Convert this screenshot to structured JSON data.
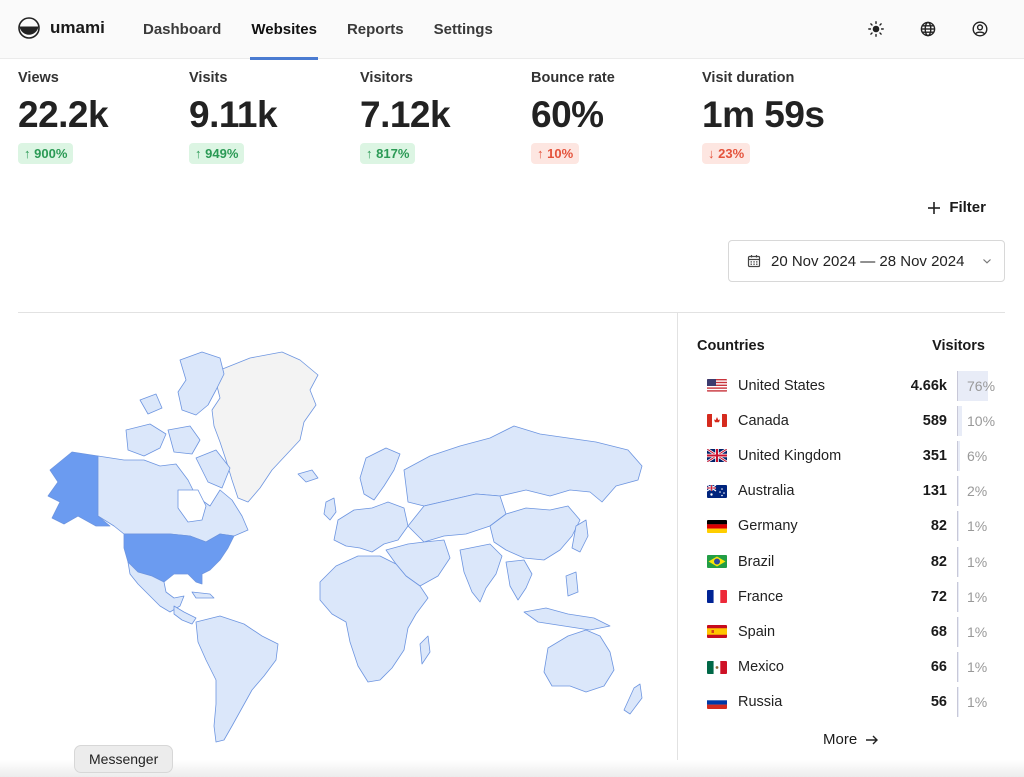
{
  "app": {
    "name": "umami"
  },
  "nav": {
    "items": [
      {
        "label": "Dashboard",
        "active": false
      },
      {
        "label": "Websites",
        "active": true
      },
      {
        "label": "Reports",
        "active": false
      },
      {
        "label": "Settings",
        "active": false
      }
    ]
  },
  "top_icons": [
    "sun-icon",
    "globe-icon",
    "user-icon"
  ],
  "metrics": [
    {
      "label": "Views",
      "value": "22.2k",
      "change": "900%",
      "direction": "up",
      "sentiment": "good"
    },
    {
      "label": "Visits",
      "value": "9.11k",
      "change": "949%",
      "direction": "up",
      "sentiment": "good"
    },
    {
      "label": "Visitors",
      "value": "7.12k",
      "change": "817%",
      "direction": "up",
      "sentiment": "good"
    },
    {
      "label": "Bounce rate",
      "value": "60%",
      "change": "10%",
      "direction": "up",
      "sentiment": "bad"
    },
    {
      "label": "Visit duration",
      "value": "1m 59s",
      "change": "23%",
      "direction": "down",
      "sentiment": "bad"
    }
  ],
  "filter": {
    "label": "Filter"
  },
  "date_range": {
    "label": "20 Nov 2024 — 28 Nov 2024"
  },
  "countries": {
    "header_left": "Countries",
    "header_right": "Visitors",
    "rows": [
      {
        "name": "United States",
        "code": "us",
        "count": "4.66k",
        "pct": "76%",
        "share": 76
      },
      {
        "name": "Canada",
        "code": "ca",
        "count": "589",
        "pct": "10%",
        "share": 10
      },
      {
        "name": "United Kingdom",
        "code": "gb",
        "count": "351",
        "pct": "6%",
        "share": 6
      },
      {
        "name": "Australia",
        "code": "au",
        "count": "131",
        "pct": "2%",
        "share": 2
      },
      {
        "name": "Germany",
        "code": "de",
        "count": "82",
        "pct": "1%",
        "share": 1
      },
      {
        "name": "Brazil",
        "code": "br",
        "count": "82",
        "pct": "1%",
        "share": 1
      },
      {
        "name": "France",
        "code": "fr",
        "count": "72",
        "pct": "1%",
        "share": 1
      },
      {
        "name": "Spain",
        "code": "es",
        "count": "68",
        "pct": "1%",
        "share": 1
      },
      {
        "name": "Mexico",
        "code": "mx",
        "count": "66",
        "pct": "1%",
        "share": 1
      },
      {
        "name": "Russia",
        "code": "ru",
        "count": "56",
        "pct": "1%",
        "share": 1
      }
    ],
    "more_label": "More"
  },
  "map": {
    "colors": {
      "high": "#6b9bf0",
      "low": "#dbe7fa",
      "none": "#f3f3f3",
      "stroke": "#6d95e0"
    }
  },
  "tooltip": {
    "text": "Messenger"
  }
}
